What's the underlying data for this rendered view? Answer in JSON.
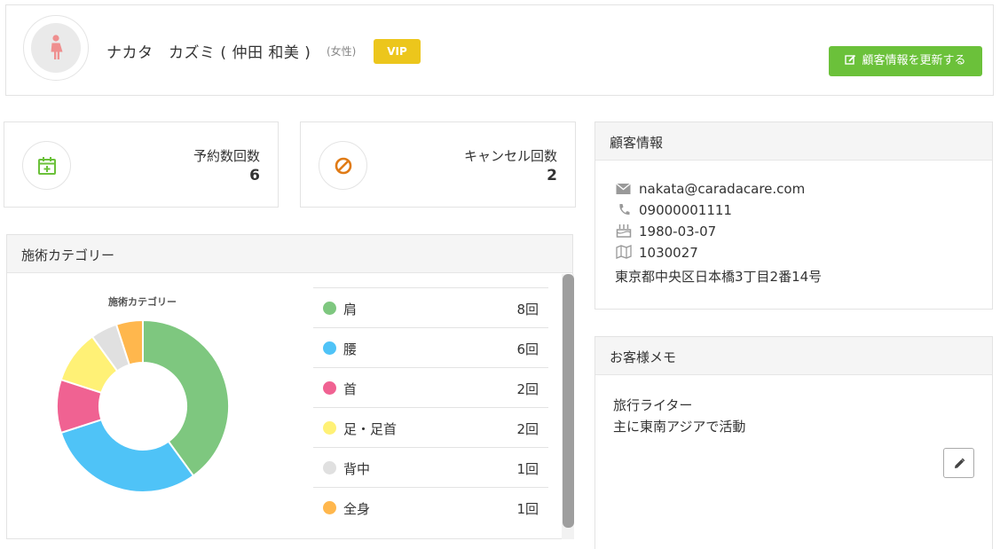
{
  "customer": {
    "name": "ナカタ　カズミ ( 仲田 和美 )",
    "gender": "(女性)",
    "badge": "VIP",
    "update_button": "顧客情報を更新する"
  },
  "stats": [
    {
      "label": "予約数回数",
      "value": "6"
    },
    {
      "label": "キャンセル回数",
      "value": "2"
    }
  ],
  "category_panel": {
    "heading": "施術カテゴリー",
    "chart_title": "施術カテゴリー",
    "items": [
      {
        "label": "肩",
        "count": "8回",
        "color": "#7ec77f"
      },
      {
        "label": "腰",
        "count": "6回",
        "color": "#4fc3f7"
      },
      {
        "label": "首",
        "count": "2回",
        "color": "#f06292"
      },
      {
        "label": "足・足首",
        "count": "2回",
        "color": "#fff176"
      },
      {
        "label": "背中",
        "count": "1回",
        "color": "#e0e0e0"
      },
      {
        "label": "全身",
        "count": "1回",
        "color": "#ffb74d"
      }
    ]
  },
  "chart_data": {
    "type": "pie",
    "title": "施術カテゴリー",
    "categories": [
      "肩",
      "腰",
      "首",
      "足・足首",
      "背中",
      "全身"
    ],
    "values": [
      8,
      6,
      2,
      2,
      1,
      1
    ],
    "colors": [
      "#7ec77f",
      "#4fc3f7",
      "#f06292",
      "#fff176",
      "#e0e0e0",
      "#ffb74d"
    ],
    "hole": true
  },
  "info_panel": {
    "heading": "顧客情報",
    "email": "nakata@caradacare.com",
    "phone": "09000001111",
    "birthday": "1980-03-07",
    "postal": "1030027",
    "address": "東京都中央区日本橋3丁目2番14号",
    "icons": [
      "envelope-icon",
      "phone-icon",
      "birthday-cake-icon",
      "map-icon"
    ]
  },
  "memo_panel": {
    "heading": "お客様メモ",
    "lines": [
      "旅行ライター",
      "主に東南アジアで活動"
    ]
  },
  "colors": {
    "accent_green": "#6bc13a",
    "vip_yellow": "#ecc61c",
    "cancel_orange": "#e07b16"
  }
}
